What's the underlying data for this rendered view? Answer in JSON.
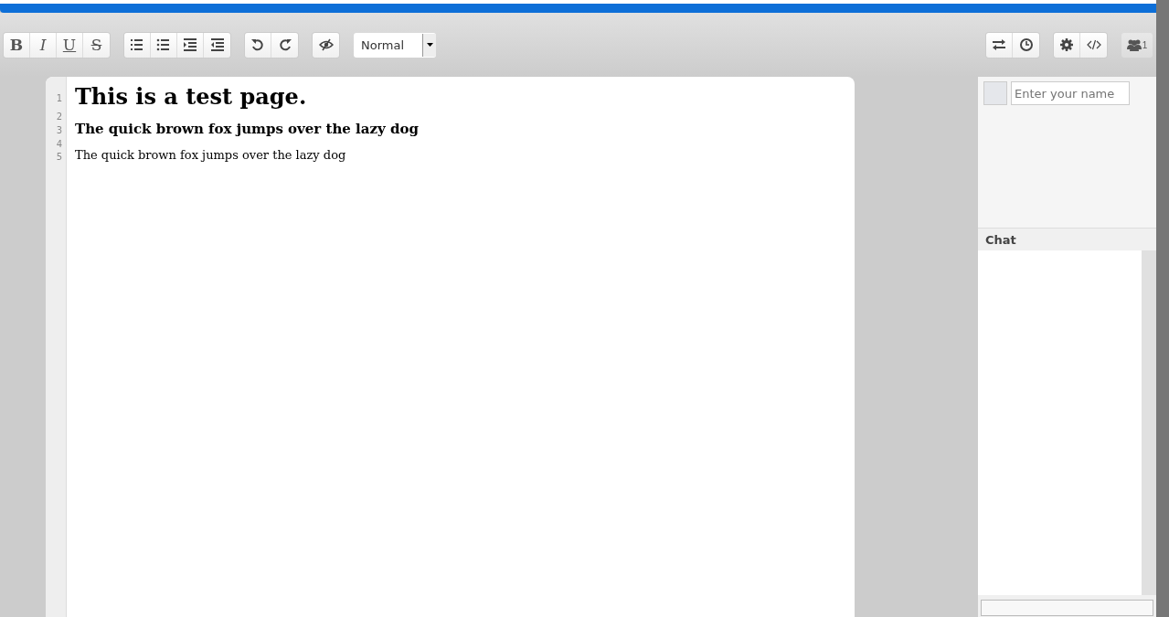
{
  "toolbar": {
    "format_buttons": [
      {
        "label": "B",
        "kind": "bold"
      },
      {
        "label": "I",
        "kind": "italic"
      },
      {
        "label": "U",
        "kind": "underline"
      },
      {
        "label": "S",
        "kind": "strike"
      }
    ],
    "list_buttons": [
      {
        "kind": "ordered-list"
      },
      {
        "kind": "bullet-list"
      },
      {
        "kind": "indent"
      },
      {
        "kind": "outdent"
      }
    ],
    "history_buttons": [
      {
        "kind": "undo"
      },
      {
        "kind": "redo"
      }
    ],
    "style_select": {
      "value": "Normal"
    },
    "right_groups": [
      [
        {
          "kind": "import-export"
        },
        {
          "kind": "timeslider"
        }
      ],
      [
        {
          "kind": "settings"
        },
        {
          "kind": "embed"
        }
      ]
    ],
    "users_count": "1"
  },
  "editor": {
    "lines": [
      {
        "number": "1",
        "kind": "h1",
        "text": "This is a test page."
      },
      {
        "number": "2",
        "kind": "empty"
      },
      {
        "number": "3",
        "kind": "h2",
        "text": "The quick brown fox jumps over the lazy dog"
      },
      {
        "number": "4",
        "kind": "empty"
      },
      {
        "number": "5",
        "kind": "p",
        "text": "The quick brown fox jumps over the lazy dog"
      }
    ]
  },
  "users": {
    "name_placeholder": "Enter your name"
  },
  "chat": {
    "title": "Chat"
  }
}
